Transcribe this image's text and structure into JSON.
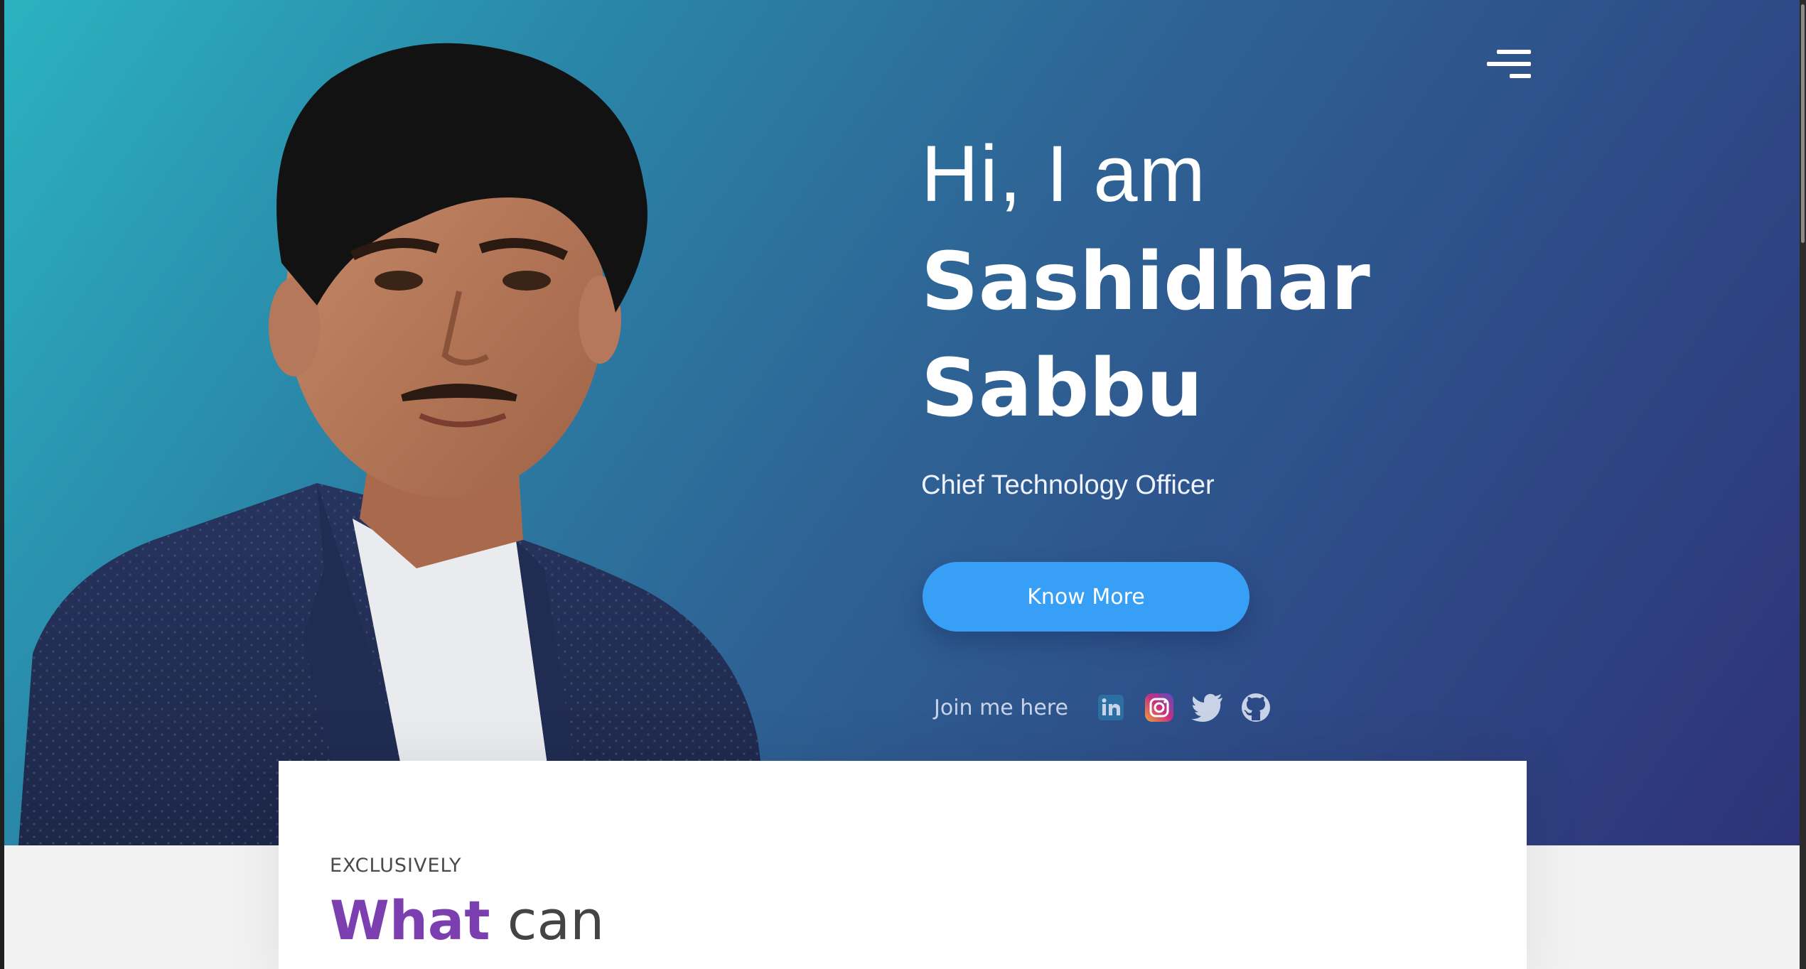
{
  "header": {
    "menu_icon": "hamburger-menu-icon"
  },
  "hero": {
    "greeting": "Hi, I am",
    "first_name": "Sashidhar",
    "last_name": "Sabbu",
    "role": "Chief Technology Officer",
    "cta_label": "Know More",
    "social_label": "Join me here",
    "social_links": [
      {
        "name": "LinkedIn",
        "icon": "linkedin-icon",
        "color": "#2c6fa3"
      },
      {
        "name": "Instagram",
        "icon": "instagram-icon",
        "color": "#b03a8a"
      },
      {
        "name": "Twitter",
        "icon": "twitter-icon",
        "color": "#c9d3e8"
      },
      {
        "name": "GitHub",
        "icon": "github-icon",
        "color": "#c9d3e8"
      }
    ],
    "gradient": [
      "#2bb2c1",
      "#2e6395",
      "#2e3377"
    ]
  },
  "section": {
    "eyebrow": "EXCLUSIVELY",
    "headline_accent": "What",
    "headline_rest": " can"
  },
  "colors": {
    "accent_button": "#37a0f6",
    "headline_accent": "#7b3fb0"
  }
}
